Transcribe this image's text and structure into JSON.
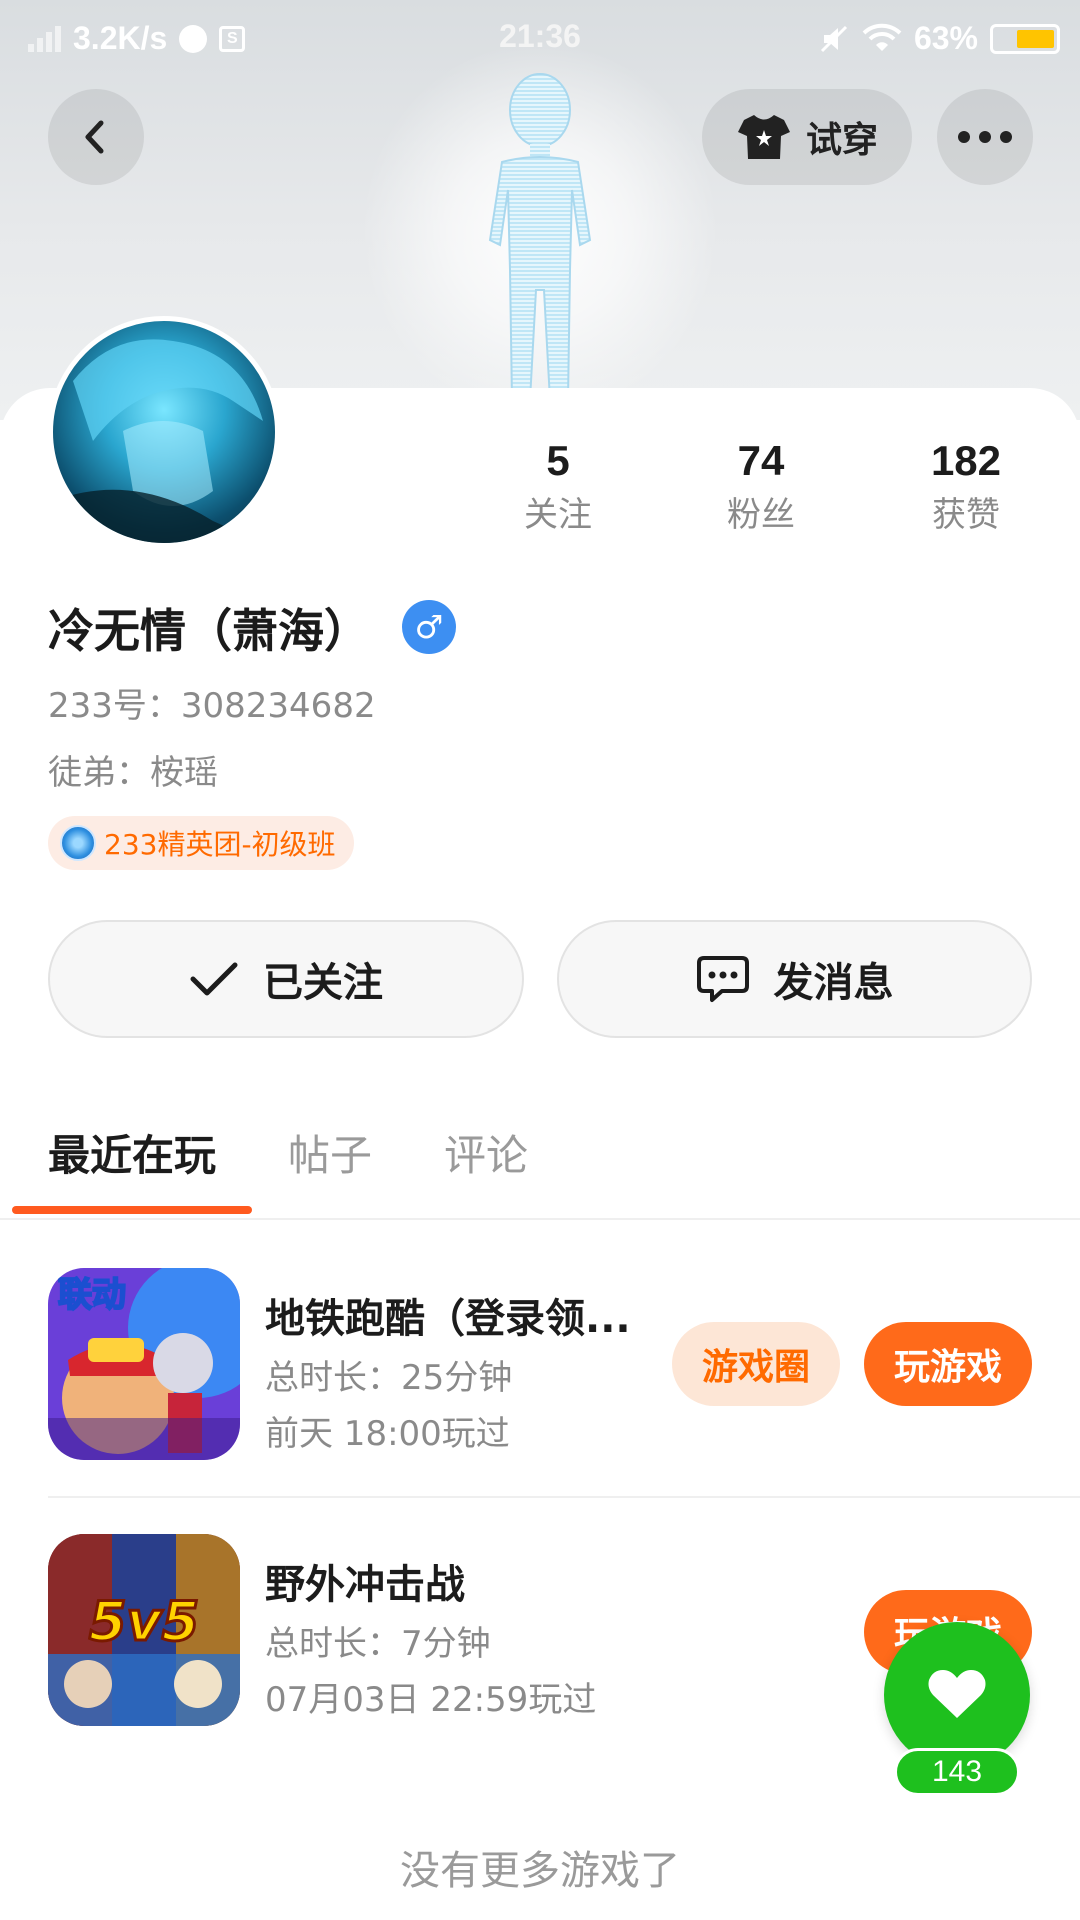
{
  "status_bar": {
    "net_speed": "3.2K/s",
    "time": "21:36",
    "battery": "63%",
    "battery_level": 0.63
  },
  "header": {
    "try_on_label": "试穿"
  },
  "profile": {
    "stats": [
      {
        "value": "5",
        "label": "关注"
      },
      {
        "value": "74",
        "label": "粉丝"
      },
      {
        "value": "182",
        "label": "获赞"
      }
    ],
    "name": "冷无情（萧海）",
    "gender_symbol": "♂",
    "id_line": "233号：308234682",
    "apprentice_line": "徒弟：桉瑶",
    "badge": "233精英团-初级班"
  },
  "actions": {
    "following_label": "已关注",
    "message_label": "发消息"
  },
  "tabs": [
    {
      "label": "最近在玩",
      "active": true
    },
    {
      "label": "帖子",
      "active": false
    },
    {
      "label": "评论",
      "active": false
    }
  ],
  "games": [
    {
      "title": "地铁跑酷（登录领...",
      "duration": "总时长：25分钟",
      "last_played": "前天 18:00玩过",
      "icon_text": "联动",
      "circle_label": "游戏圈",
      "play_label": "玩游戏"
    },
    {
      "title": "野外冲击战",
      "duration": "总时长：7分钟",
      "last_played": "07月03日 22:59玩过",
      "icon_text": "5v5",
      "play_label": "玩游戏"
    }
  ],
  "footer": {
    "no_more": "没有更多游戏了"
  },
  "like": {
    "count": "143"
  },
  "colors": {
    "accent": "#ff6a1a",
    "like_green": "#1ec01e",
    "male_blue": "#3d8ff2"
  }
}
